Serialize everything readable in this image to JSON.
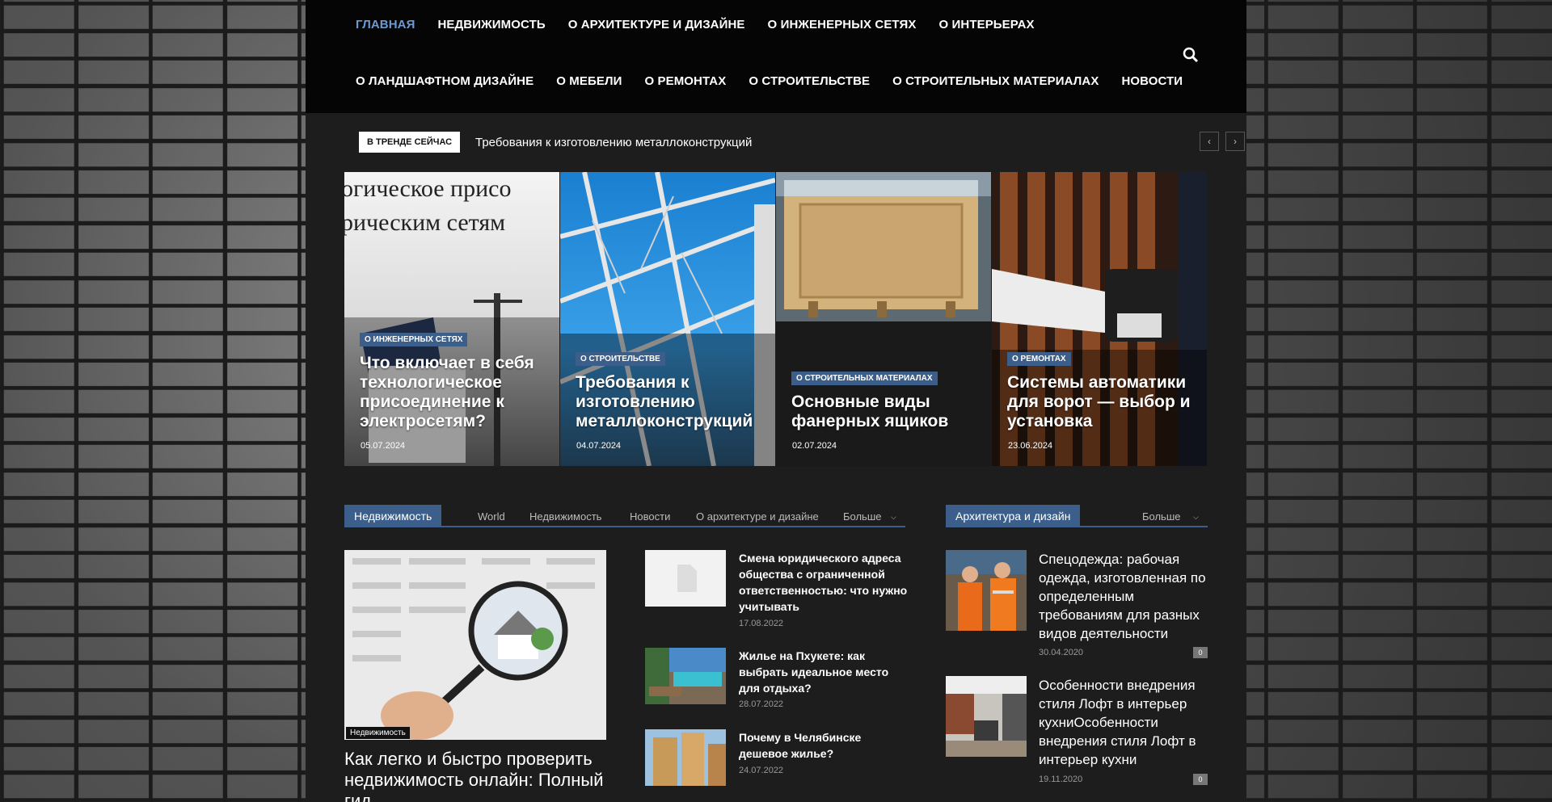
{
  "nav": {
    "row1": [
      "ГЛАВНАЯ",
      "НЕДВИЖИМОСТЬ",
      "О АРХИТЕКТУРЕ И ДИЗАЙНЕ",
      "О ИНЖЕНЕРНЫХ СЕТЯХ",
      "О ИНТЕРЬЕРАХ"
    ],
    "row2": [
      "О ЛАНДШАФТНОМ ДИЗАЙНЕ",
      "О МЕБЕЛИ",
      "О РЕМОНТАХ",
      "О СТРОИТЕЛЬСТВЕ",
      "О СТРОИТЕЛЬНЫХ МАТЕРИАЛАХ",
      "НОВОСТИ"
    ],
    "search_icon": "search-icon"
  },
  "trending": {
    "label": "В ТРЕНДЕ СЕЙЧАС",
    "text": "Требования к изготовлению металлоконструкций",
    "prev": "‹",
    "next": "›"
  },
  "slider": [
    {
      "category": "О ИНЖЕНЕРНЫХ СЕТЯХ",
      "title": "Что включает в себя технологическое присоединение к электросетям?",
      "date": "05.07.2024",
      "image_text_1": "огическое присо",
      "image_text_2": "рическим сетям"
    },
    {
      "category": "О СТРОИТЕЛЬСТВЕ",
      "title": "Требования к изготовлению металлоконструкций",
      "date": "04.07.2024"
    },
    {
      "category": "О СТРОИТЕЛЬНЫХ МАТЕРИАЛАХ",
      "title": "Основные виды фанерных ящиков",
      "date": "02.07.2024"
    },
    {
      "category": "О РЕМОНТАХ",
      "title": "Системы автоматики для ворот — выбор и установка",
      "date": "23.06.2024"
    }
  ],
  "realty": {
    "title": "Недвижимость",
    "tabs": [
      "World",
      "Недвижимость",
      "Новости",
      "О архитектуре и дизайне",
      "Больше"
    ],
    "big": {
      "category": "Недвижимость",
      "title": "Как легко и быстро проверить недвижимость онлайн: Полный гид"
    },
    "items": [
      {
        "title": "Смена юридического адреса общества с ограниченной ответственностью: что нужно учитывать",
        "date": "17.08.2022"
      },
      {
        "title": "Жилье на Пхукете: как выбрать идеальное место для отдыха?",
        "date": "28.07.2022"
      },
      {
        "title": "Почему в Челябинске дешевое жилье?",
        "date": "24.07.2022"
      }
    ]
  },
  "arch": {
    "title": "Архитектура и дизайн",
    "more": "Больше",
    "items": [
      {
        "title": "Спецодежда: рабочая одежда, изготовленная по определенным требованиям для разных видов деятельности",
        "date": "30.04.2020",
        "count": "0"
      },
      {
        "title": "Особенности внедрения стиля Лофт в интерьер кухниОсобенности внедрения стиля Лофт в интерьер кухни",
        "date": "19.11.2020",
        "count": "0"
      }
    ]
  },
  "colors": {
    "accent": "#3b5f8a",
    "active_nav": "#6b9bd2",
    "header_bg": "#050505",
    "page_bg": "#1d1d1d"
  }
}
